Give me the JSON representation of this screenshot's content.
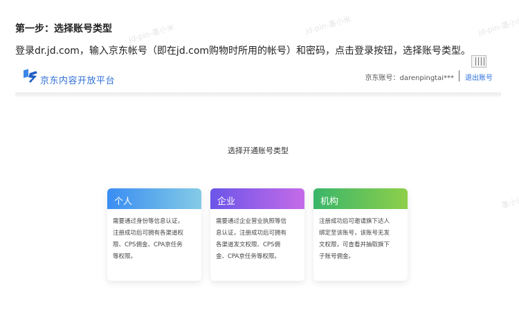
{
  "instructions": {
    "step_title": "第一步：选择账号类型",
    "step_desc": "登录dr.jd.com，输入京东帐号（即在jd.com购物时所用的帐号）和密码，点击登录按钮，选择账号类型。"
  },
  "watermark": "jd-pin-墨小米",
  "header": {
    "logo_text": "京东内容开放平台",
    "account_text": "京东账号：darenpingtai***",
    "logout_label": "退出账号"
  },
  "main": {
    "title": "选择开通账号类型",
    "cards": [
      {
        "title": "个人",
        "lines": [
          "需要通过身份等信息认证，",
          "注册成功后可拥有各渠道权",
          "限、CPS佣金、CPA京任务",
          "等权限。"
        ]
      },
      {
        "title": "企业",
        "lines": [
          "需要通过企业营业执照等信",
          "息认证，注册成功后可拥有",
          "各渠道发文权限、CPS佣",
          "金、CPA京任务等权限。"
        ]
      },
      {
        "title": "机构",
        "lines": [
          "注册成功后可邀请旗下达人",
          "绑定至该账号，该账号无发",
          "文权限，可查看并抽取旗下",
          "子账号佣金。"
        ]
      }
    ]
  },
  "colors": {
    "brand_blue": "#2f6fd6",
    "card_personal": "#3a8df2",
    "card_enterprise": "#6b55e8",
    "card_institution": "#39b66a"
  }
}
